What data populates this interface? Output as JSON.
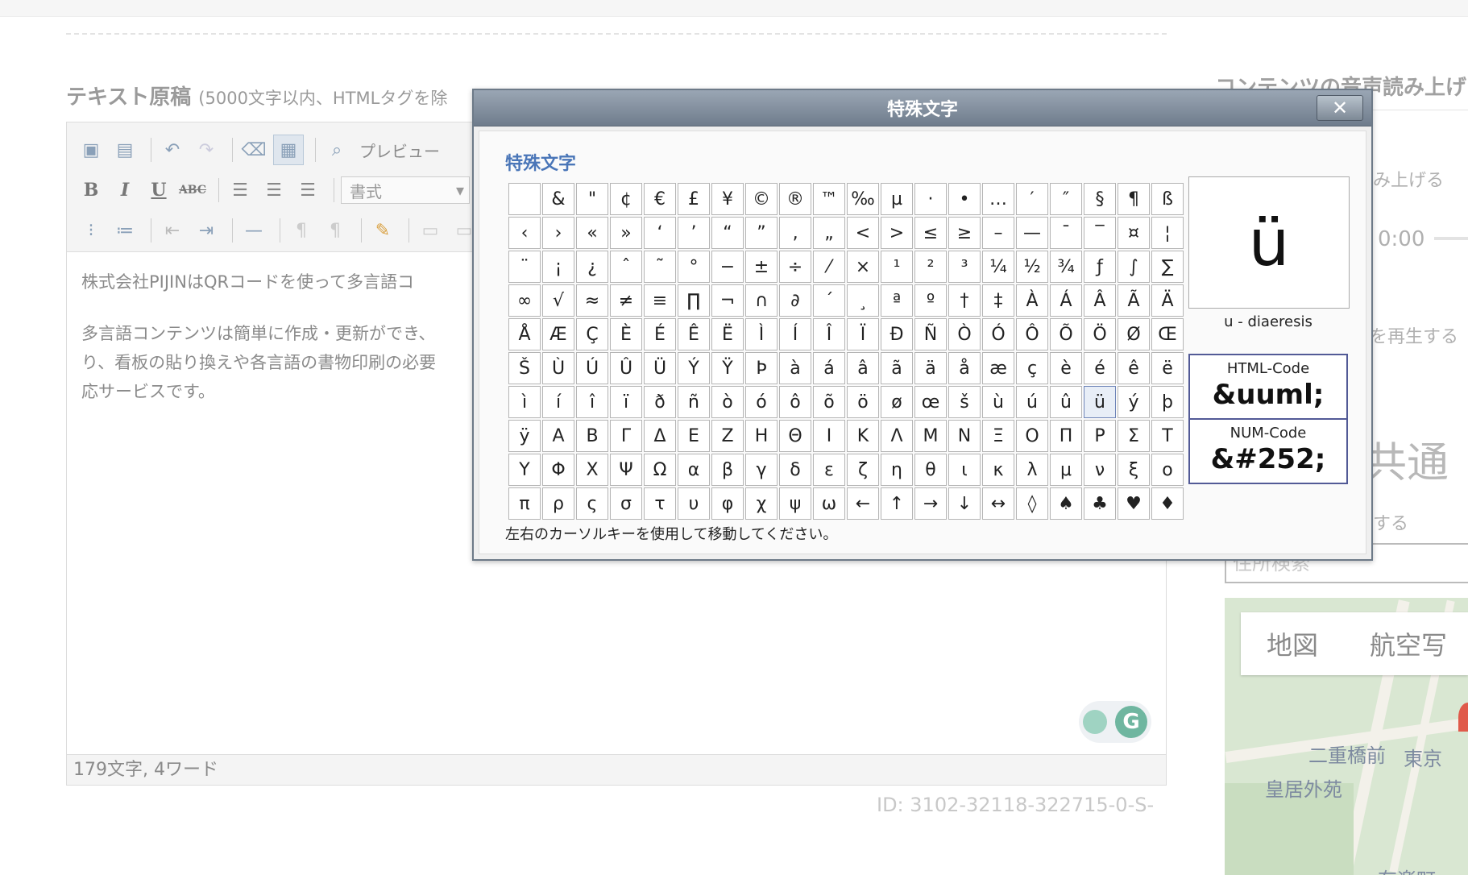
{
  "page": {
    "section_title": "テキスト原稿",
    "section_subtitle": "(5000文字以内、HTMLタグを除",
    "id_text": "ID: 3102-32118-322715-0-S-",
    "right_title": "コンテンツの音声読み上げ",
    "right_text1": "み上げる",
    "right_text2": "0:00",
    "right_text3": "を再生する",
    "right_big": "共通",
    "right_text4": "する",
    "address_search": "住所検索"
  },
  "editor": {
    "toolbar": {
      "preview_label": "プレビュー",
      "format_label": "書式"
    },
    "paragraphs": [
      "株式会社PIJINはQRコードを使って多言語コ",
      "多言語コンテンツは簡単に作成・更新ができ、",
      "り、看板の貼り換えや各言語の書物印刷の必要",
      "応サービスです。"
    ],
    "status": "179文字, 4ワード"
  },
  "map": {
    "tab_map": "地図",
    "tab_aerial": "航空写",
    "labels": [
      "二重橋前",
      "東京",
      "皇居外苑",
      "有楽町"
    ]
  },
  "dialog": {
    "title": "特殊文字",
    "subtitle": "特殊文字",
    "close": "✕",
    "chars": [
      "",
      "&",
      "\"",
      "¢",
      "€",
      "£",
      "¥",
      "©",
      "®",
      "™",
      "‰",
      "µ",
      "·",
      "•",
      "…",
      "′",
      "″",
      "§",
      "¶",
      "ß",
      "‹",
      "›",
      "«",
      "»",
      "‘",
      "’",
      "“",
      "”",
      "‚",
      "„",
      "<",
      ">",
      "≤",
      "≥",
      "–",
      "—",
      "¯",
      "‾",
      "¤",
      "¦",
      "¨",
      "¡",
      "¿",
      "ˆ",
      "˜",
      "°",
      "−",
      "±",
      "÷",
      "⁄",
      "×",
      "¹",
      "²",
      "³",
      "¼",
      "½",
      "¾",
      "ƒ",
      "∫",
      "∑",
      "∞",
      "√",
      "≈",
      "≠",
      "≡",
      "∏",
      "¬",
      "∩",
      "∂",
      "´",
      "¸",
      "ª",
      "º",
      "†",
      "‡",
      "À",
      "Á",
      "Â",
      "Ã",
      "Ä",
      "Å",
      "Æ",
      "Ç",
      "È",
      "É",
      "Ê",
      "Ë",
      "Ì",
      "Í",
      "Î",
      "Ï",
      "Ð",
      "Ñ",
      "Ò",
      "Ó",
      "Ô",
      "Õ",
      "Ö",
      "Ø",
      "Œ",
      "Š",
      "Ù",
      "Ú",
      "Û",
      "Ü",
      "Ý",
      "Ÿ",
      "Þ",
      "à",
      "á",
      "â",
      "ã",
      "ä",
      "å",
      "æ",
      "ç",
      "è",
      "é",
      "ê",
      "ë",
      "ì",
      "í",
      "î",
      "ï",
      "ð",
      "ñ",
      "ò",
      "ó",
      "ô",
      "õ",
      "ö",
      "ø",
      "œ",
      "š",
      "ù",
      "ú",
      "û",
      "ü",
      "ý",
      "þ",
      "ÿ",
      "Α",
      "Β",
      "Γ",
      "Δ",
      "Ε",
      "Ζ",
      "Η",
      "Θ",
      "Ι",
      "Κ",
      "Λ",
      "Μ",
      "Ν",
      "Ξ",
      "Ο",
      "Π",
      "Ρ",
      "Σ",
      "Τ",
      "Υ",
      "Φ",
      "Χ",
      "Ψ",
      "Ω",
      "α",
      "β",
      "γ",
      "δ",
      "ε",
      "ζ",
      "η",
      "θ",
      "ι",
      "κ",
      "λ",
      "μ",
      "ν",
      "ξ",
      "ο",
      "π",
      "ρ",
      "ς",
      "σ",
      "τ",
      "υ",
      "φ",
      "χ",
      "ψ",
      "ω",
      "←",
      "↑",
      "→",
      "↓",
      "↔",
      "◊",
      "♠",
      "♣",
      "♥",
      "♦"
    ],
    "selected_char": "ü",
    "char_name": "u - diaeresis",
    "html_code_label": "HTML-Code",
    "html_code": "&uuml;",
    "num_code_label": "NUM-Code",
    "num_code": "&#252;",
    "footer": "左右のカーソルキーを使用して移動してください。"
  }
}
